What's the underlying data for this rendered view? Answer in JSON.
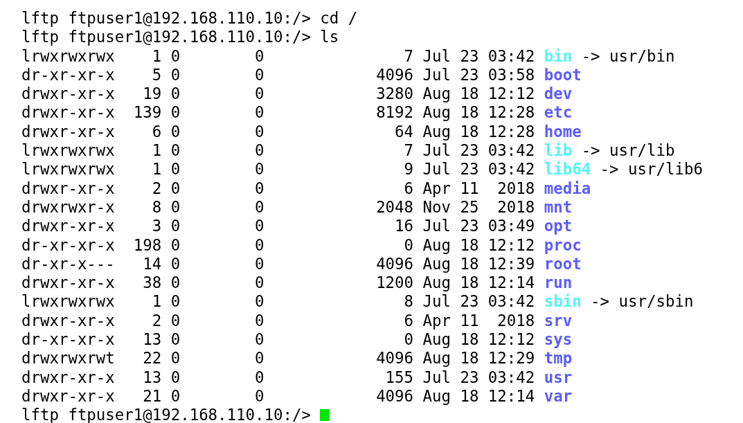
{
  "commands": [
    {
      "text": "lftp ftpuser1@192.168.110.10:/> cd /"
    },
    {
      "text": "lftp ftpuser1@192.168.110.10:/> ls"
    }
  ],
  "listing": [
    {
      "permissions": "lrwxrwxrwx",
      "links": "1",
      "owner": "0",
      "group": "0",
      "size": "7",
      "month": "Jul",
      "day": "23",
      "time": "03:42",
      "name": "bin",
      "kind": "link",
      "arrow": "->",
      "target": "usr/bin"
    },
    {
      "permissions": "dr-xr-xr-x",
      "links": "5",
      "owner": "0",
      "group": "0",
      "size": "4096",
      "month": "Jul",
      "day": "23",
      "time": "03:58",
      "name": "boot",
      "kind": "dir"
    },
    {
      "permissions": "drwxr-xr-x",
      "links": "19",
      "owner": "0",
      "group": "0",
      "size": "3280",
      "month": "Aug",
      "day": "18",
      "time": "12:12",
      "name": "dev",
      "kind": "dir"
    },
    {
      "permissions": "drwxr-xr-x",
      "links": "139",
      "owner": "0",
      "group": "0",
      "size": "8192",
      "month": "Aug",
      "day": "18",
      "time": "12:28",
      "name": "etc",
      "kind": "dir"
    },
    {
      "permissions": "drwxr-xr-x",
      "links": "6",
      "owner": "0",
      "group": "0",
      "size": "64",
      "month": "Aug",
      "day": "18",
      "time": "12:28",
      "name": "home",
      "kind": "dir"
    },
    {
      "permissions": "lrwxrwxrwx",
      "links": "1",
      "owner": "0",
      "group": "0",
      "size": "7",
      "month": "Jul",
      "day": "23",
      "time": "03:42",
      "name": "lib",
      "kind": "link",
      "arrow": "->",
      "target": "usr/lib"
    },
    {
      "permissions": "lrwxrwxrwx",
      "links": "1",
      "owner": "0",
      "group": "0",
      "size": "9",
      "month": "Jul",
      "day": "23",
      "time": "03:42",
      "name": "lib64",
      "kind": "link",
      "arrow": "->",
      "target": "usr/lib6"
    },
    {
      "permissions": "drwxr-xr-x",
      "links": "2",
      "owner": "0",
      "group": "0",
      "size": "6",
      "month": "Apr",
      "day": "11",
      "time": "2018",
      "name": "media",
      "kind": "dir"
    },
    {
      "permissions": "drwxrwxr-x",
      "links": "8",
      "owner": "0",
      "group": "0",
      "size": "2048",
      "month": "Nov",
      "day": "25",
      "time": "2018",
      "name": "mnt",
      "kind": "dir"
    },
    {
      "permissions": "drwxr-xr-x",
      "links": "3",
      "owner": "0",
      "group": "0",
      "size": "16",
      "month": "Jul",
      "day": "23",
      "time": "03:49",
      "name": "opt",
      "kind": "dir"
    },
    {
      "permissions": "dr-xr-xr-x",
      "links": "198",
      "owner": "0",
      "group": "0",
      "size": "0",
      "month": "Aug",
      "day": "18",
      "time": "12:12",
      "name": "proc",
      "kind": "dir"
    },
    {
      "permissions": "dr-xr-x---",
      "links": "14",
      "owner": "0",
      "group": "0",
      "size": "4096",
      "month": "Aug",
      "day": "18",
      "time": "12:39",
      "name": "root",
      "kind": "dir"
    },
    {
      "permissions": "drwxr-xr-x",
      "links": "38",
      "owner": "0",
      "group": "0",
      "size": "1200",
      "month": "Aug",
      "day": "18",
      "time": "12:14",
      "name": "run",
      "kind": "dir"
    },
    {
      "permissions": "lrwxrwxrwx",
      "links": "1",
      "owner": "0",
      "group": "0",
      "size": "8",
      "month": "Jul",
      "day": "23",
      "time": "03:42",
      "name": "sbin",
      "kind": "link",
      "arrow": "->",
      "target": "usr/sbin"
    },
    {
      "permissions": "drwxr-xr-x",
      "links": "2",
      "owner": "0",
      "group": "0",
      "size": "6",
      "month": "Apr",
      "day": "11",
      "time": "2018",
      "name": "srv",
      "kind": "dir"
    },
    {
      "permissions": "dr-xr-xr-x",
      "links": "13",
      "owner": "0",
      "group": "0",
      "size": "0",
      "month": "Aug",
      "day": "18",
      "time": "12:12",
      "name": "sys",
      "kind": "dir"
    },
    {
      "permissions": "drwxrwxrwt",
      "links": "22",
      "owner": "0",
      "group": "0",
      "size": "4096",
      "month": "Aug",
      "day": "18",
      "time": "12:29",
      "name": "tmp",
      "kind": "dir"
    },
    {
      "permissions": "drwxr-xr-x",
      "links": "13",
      "owner": "0",
      "group": "0",
      "size": "155",
      "month": "Jul",
      "day": "23",
      "time": "03:42",
      "name": "usr",
      "kind": "dir"
    },
    {
      "permissions": "drwxr-xr-x",
      "links": "21",
      "owner": "0",
      "group": "0",
      "size": "4096",
      "month": "Aug",
      "day": "18",
      "time": "12:14",
      "name": "var",
      "kind": "dir"
    }
  ],
  "prompt": {
    "text": "lftp ftpuser1@192.168.110.10:/>",
    "cursor": true
  }
}
